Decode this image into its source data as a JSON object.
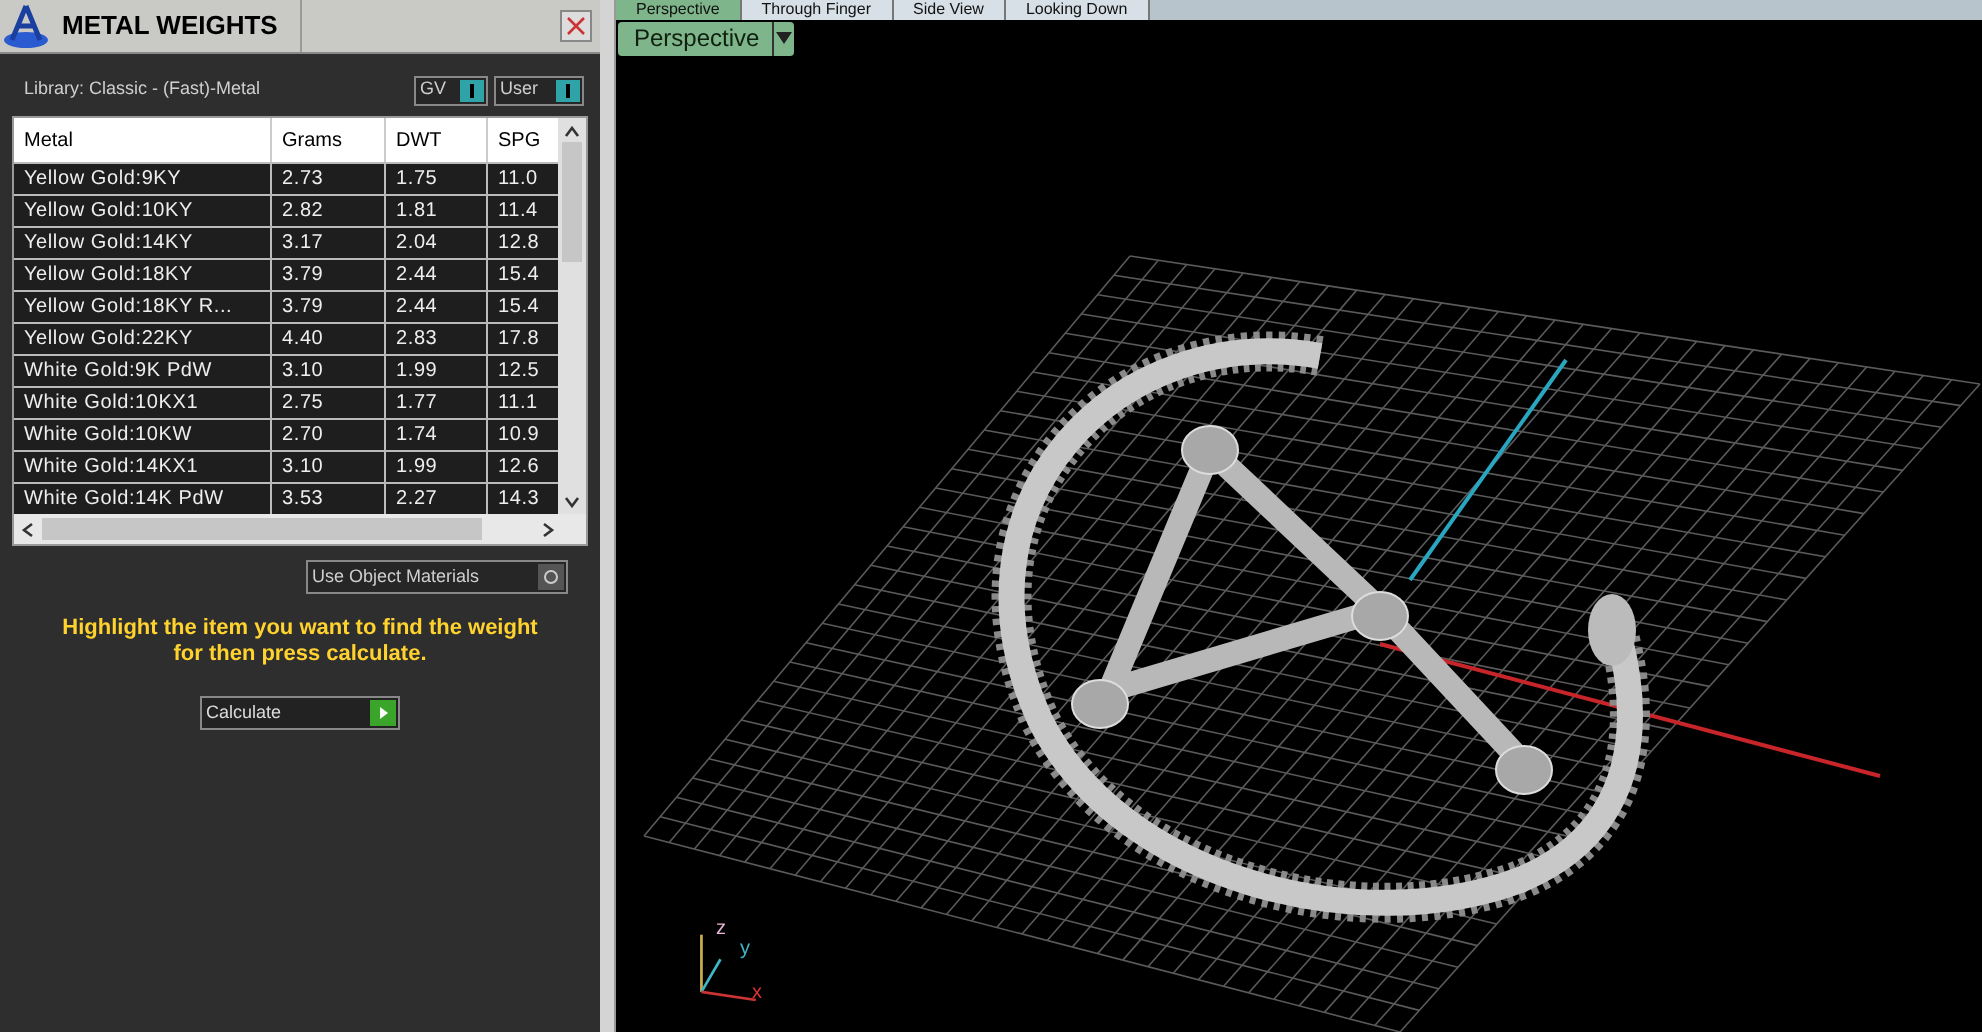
{
  "panel": {
    "title": "METAL WEIGHTS",
    "library": "Library: Classic - (Fast)-Metal",
    "toggles": [
      {
        "label": "GV",
        "on": true
      },
      {
        "label": "User",
        "on": true
      }
    ]
  },
  "table": {
    "columns": [
      "Metal",
      "Grams",
      "DWT",
      "SPG"
    ],
    "rows": [
      [
        "Yellow Gold:9KY",
        "2.73",
        "1.75",
        "11.0"
      ],
      [
        "Yellow Gold:10KY",
        "2.82",
        "1.81",
        "11.4"
      ],
      [
        "Yellow Gold:14KY",
        "3.17",
        "2.04",
        "12.8"
      ],
      [
        "Yellow Gold:18KY",
        "3.79",
        "2.44",
        "15.4"
      ],
      [
        "Yellow Gold:18KY R...",
        "3.79",
        "2.44",
        "15.4"
      ],
      [
        "Yellow Gold:22KY",
        "4.40",
        "2.83",
        "17.8"
      ],
      [
        "White Gold:9K PdW",
        "3.10",
        "1.99",
        "12.5"
      ],
      [
        "White Gold:10KX1",
        "2.75",
        "1.77",
        "11.1"
      ],
      [
        "White Gold:10KW",
        "2.70",
        "1.74",
        "10.9"
      ],
      [
        "White Gold:14KX1",
        "3.10",
        "1.99",
        "12.6"
      ],
      [
        "White Gold:14K PdW",
        "3.53",
        "2.27",
        "14.3"
      ]
    ]
  },
  "use_object_materials": {
    "label": "Use Object Materials",
    "on": false
  },
  "instruction": "Highlight the item you want to find the weight for then press calculate.",
  "calculate_button": "Calculate",
  "view_tabs": [
    {
      "label": "Perspective",
      "selected": true
    },
    {
      "label": "Through Finger",
      "selected": false
    },
    {
      "label": "Side View",
      "selected": false
    },
    {
      "label": "Looking Down",
      "selected": false
    }
  ],
  "view_dropdown": "Perspective",
  "axis_labels": [
    "z",
    "y",
    "x"
  ]
}
